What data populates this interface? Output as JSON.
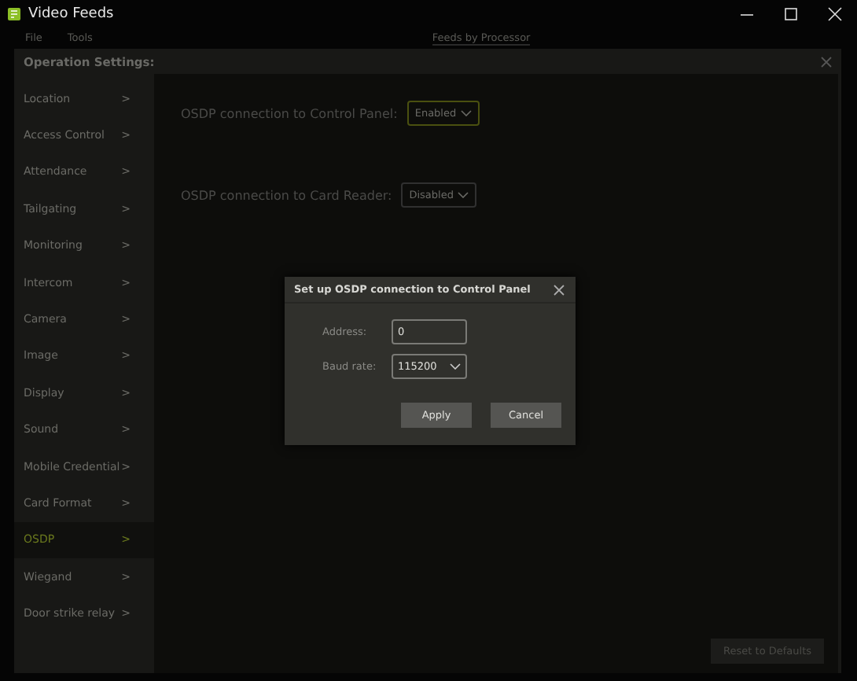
{
  "window": {
    "title": "Video Feeds"
  },
  "menu": [
    "File",
    "Tools"
  ],
  "view_tab": "Feeds by Processor",
  "panel": {
    "title": "Operation Settings:"
  },
  "sidebar": {
    "items": [
      {
        "label": "Location",
        "arrow": ">",
        "selected": false
      },
      {
        "label": "Access Control",
        "arrow": ">",
        "selected": false
      },
      {
        "label": "Attendance",
        "arrow": ">",
        "selected": false
      },
      {
        "label": "Tailgating",
        "arrow": ">",
        "selected": false
      },
      {
        "label": "Monitoring",
        "arrow": ">",
        "selected": false
      },
      {
        "label": "Intercom",
        "arrow": ">",
        "selected": false
      },
      {
        "label": "Camera",
        "arrow": ">",
        "selected": false
      },
      {
        "label": "Image",
        "arrow": ">",
        "selected": false
      },
      {
        "label": "Display",
        "arrow": ">",
        "selected": false
      },
      {
        "label": "Sound",
        "arrow": ">",
        "selected": false
      },
      {
        "label": "Mobile Credential",
        "arrow": ">",
        "selected": false
      },
      {
        "label": "Card Format",
        "arrow": ">",
        "selected": false
      },
      {
        "label": "OSDP",
        "arrow": ">",
        "selected": true
      },
      {
        "label": "Wiegand",
        "arrow": ">",
        "selected": false
      },
      {
        "label": "Door strike relay",
        "arrow": ">",
        "selected": false
      }
    ]
  },
  "settings": [
    {
      "label": "OSDP connection to Control Panel:",
      "value": "Enabled",
      "focused": true
    },
    {
      "label": "OSDP connection to Card Reader:",
      "value": "Disabled",
      "focused": false
    }
  ],
  "reset_button": "Reset to Defaults",
  "dialog": {
    "title": "Set up OSDP connection to Control Panel",
    "fields": [
      {
        "kind": "text",
        "label": "Address:",
        "value": "0"
      },
      {
        "kind": "select",
        "label": "Baud rate:",
        "value": "115200"
      }
    ],
    "buttons": [
      "Apply",
      "Cancel"
    ]
  }
}
